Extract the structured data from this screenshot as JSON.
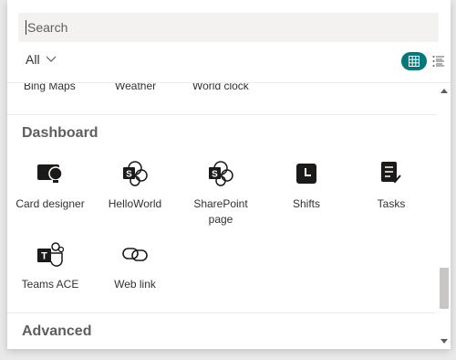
{
  "search": {
    "placeholder": "Search",
    "value": ""
  },
  "filter": {
    "label": "All"
  },
  "view": {
    "selected": "grid"
  },
  "accent_color": "#03787c",
  "partial_row": {
    "items": [
      "Bing Maps",
      "Weather",
      "World clock"
    ]
  },
  "sections": [
    {
      "title": "Dashboard",
      "tiles": [
        {
          "label": "Card designer",
          "icon": "card-designer-icon"
        },
        {
          "label": "HelloWorld",
          "icon": "sharepoint-icon"
        },
        {
          "label": "SharePoint page",
          "icon": "sharepoint-page-icon"
        },
        {
          "label": "Shifts",
          "icon": "shifts-icon"
        },
        {
          "label": "Tasks",
          "icon": "tasks-icon"
        },
        {
          "label": "Teams ACE",
          "icon": "teams-icon"
        },
        {
          "label": "Web link",
          "icon": "link-icon"
        }
      ]
    },
    {
      "title": "Advanced"
    }
  ]
}
